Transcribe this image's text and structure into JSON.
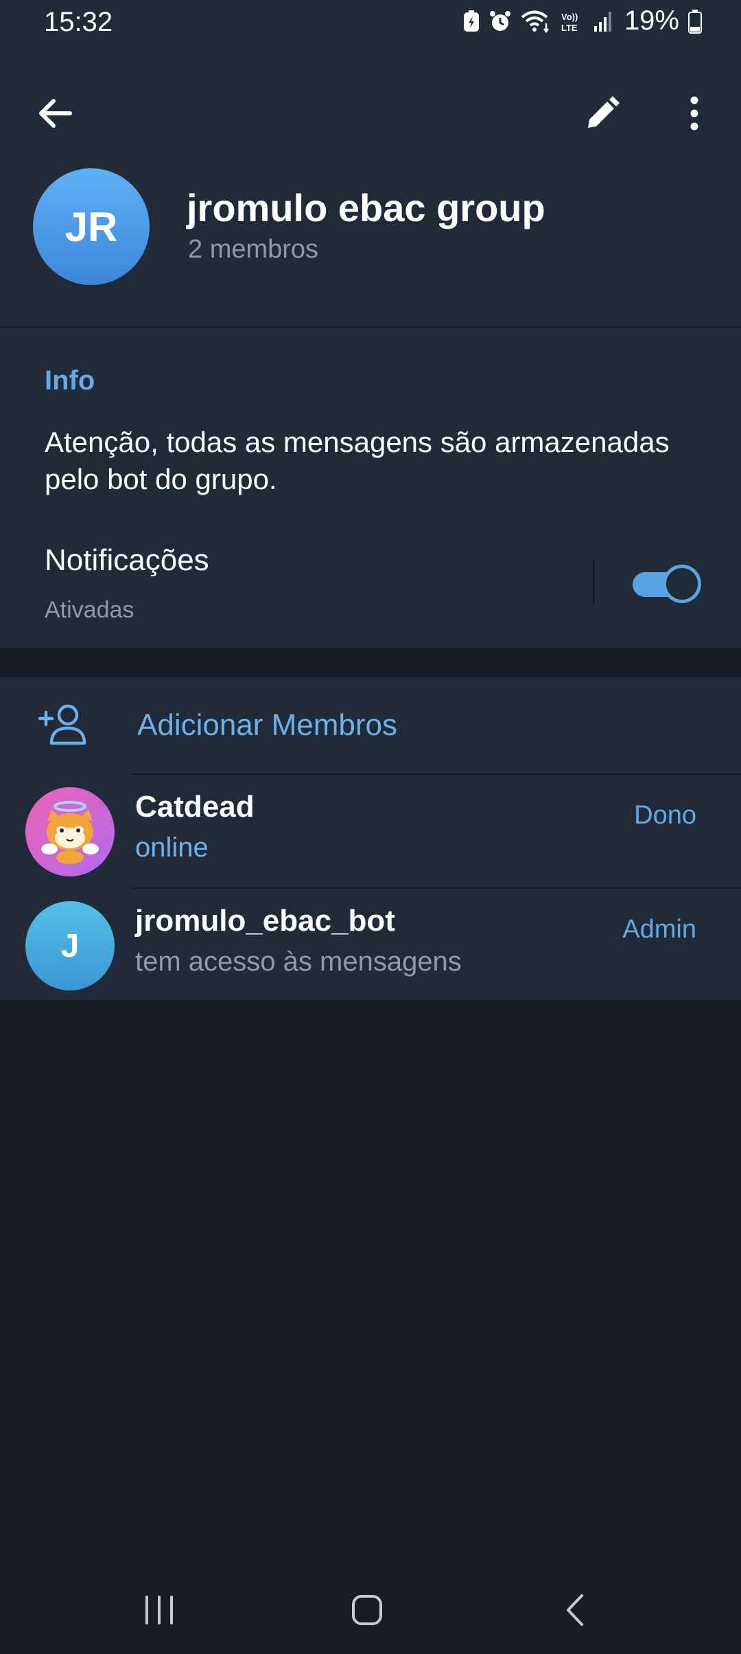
{
  "status_bar": {
    "time": "15:32",
    "battery": "19%",
    "icons": [
      "battery-saver-icon",
      "alarm-icon",
      "wifi-icon",
      "volte-icon",
      "signal-icon",
      "battery-icon"
    ]
  },
  "toolbar": {
    "icons": [
      "back-arrow-icon",
      "pencil-icon",
      "more-vertical-icon"
    ]
  },
  "group": {
    "initials": "JR",
    "title": "jromulo ebac group",
    "subtitle": "2 membros"
  },
  "info": {
    "label": "Info",
    "description": "Atenção, todas as mensagens são armazenadas pelo bot do grupo.",
    "notifications_title": "Notificações",
    "notifications_status": "Ativadas",
    "notifications_enabled": true
  },
  "members": {
    "add_label": "Adicionar Membros",
    "list": [
      {
        "name": "Catdead",
        "status": "online",
        "role": "Dono",
        "avatar": "cat-sticker-avatar"
      },
      {
        "name": "jromulo_ebac_bot",
        "status": "tem acesso às mensagens",
        "role": "Admin",
        "initials": "J"
      }
    ]
  },
  "nav_bar": {
    "icons": [
      "recent-apps-icon",
      "home-icon",
      "back-icon"
    ]
  },
  "colors": {
    "background": "#171c26",
    "surface": "#212a38",
    "accent": "#64a9e6",
    "muted_text": "#8f9aa8"
  }
}
